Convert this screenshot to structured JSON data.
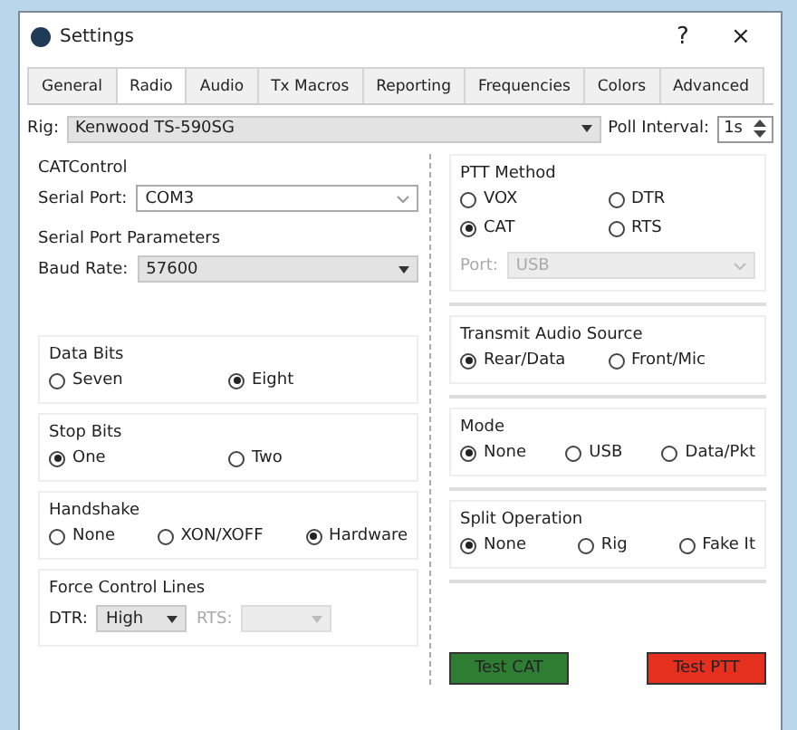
{
  "window": {
    "title": "Settings",
    "help": "?",
    "close": "×"
  },
  "tabs": [
    {
      "label": "General",
      "selected": false
    },
    {
      "label": "Radio",
      "selected": true
    },
    {
      "label": "Audio",
      "selected": false
    },
    {
      "label": "Tx Macros",
      "selected": false
    },
    {
      "label": "Reporting",
      "selected": false
    },
    {
      "label": "Frequencies",
      "selected": false
    },
    {
      "label": "Colors",
      "selected": false
    },
    {
      "label": "Advanced",
      "selected": false
    }
  ],
  "rig": {
    "label": "Rig:",
    "value": "Kenwood TS-590SG"
  },
  "poll": {
    "label": "Poll Interval:",
    "value": "1s"
  },
  "cat_control": {
    "title": "CATControl",
    "serial_port": {
      "label": "Serial Port:",
      "value": "COM3"
    },
    "serial_params": {
      "title": "Serial Port Parameters",
      "baud": {
        "label": "Baud Rate:",
        "value": "57600"
      }
    },
    "groups": [
      {
        "title": "Data Bits",
        "options": [
          {
            "label": "Seven",
            "selected": false
          },
          {
            "label": "Eight",
            "selected": true
          }
        ]
      },
      {
        "title": "Stop Bits",
        "options": [
          {
            "label": "One",
            "selected": true
          },
          {
            "label": "Two",
            "selected": false
          }
        ]
      },
      {
        "title": "Handshake",
        "options": [
          {
            "label": "None",
            "selected": false
          },
          {
            "label": "XON/XOFF",
            "selected": false
          },
          {
            "label": "Hardware",
            "selected": true
          }
        ]
      }
    ],
    "force": {
      "title": "Force Control Lines",
      "dtr": {
        "label": "DTR:",
        "value": "High",
        "disabled": false
      },
      "rts": {
        "label": "RTS:",
        "disabled": true
      }
    }
  },
  "ptt": {
    "title": "PTT Method",
    "options": [
      {
        "label": "VOX",
        "selected": false
      },
      {
        "label": "DTR",
        "selected": false
      },
      {
        "label": "CAT",
        "selected": true
      },
      {
        "label": "RTS",
        "selected": false
      }
    ],
    "port": {
      "label": "Port:",
      "value": "USB",
      "disabled": true
    }
  },
  "right_groups": [
    {
      "title": "Transmit Audio Source",
      "options": [
        {
          "label": "Rear/Data",
          "selected": true
        },
        {
          "label": "Front/Mic",
          "selected": false
        }
      ]
    },
    {
      "title": "Mode",
      "options": [
        {
          "label": "None",
          "selected": true
        },
        {
          "label": "USB",
          "selected": false
        },
        {
          "label": "Data/Pkt",
          "selected": false
        }
      ]
    },
    {
      "title": "Split Operation",
      "options": [
        {
          "label": "None",
          "selected": true
        },
        {
          "label": "Rig",
          "selected": false
        },
        {
          "label": "Fake It",
          "selected": false
        }
      ]
    }
  ],
  "buttons": [
    {
      "label": "Test CAT",
      "color": "#2e7d32"
    },
    {
      "label": "Test PTT",
      "color": "#e53020"
    }
  ]
}
